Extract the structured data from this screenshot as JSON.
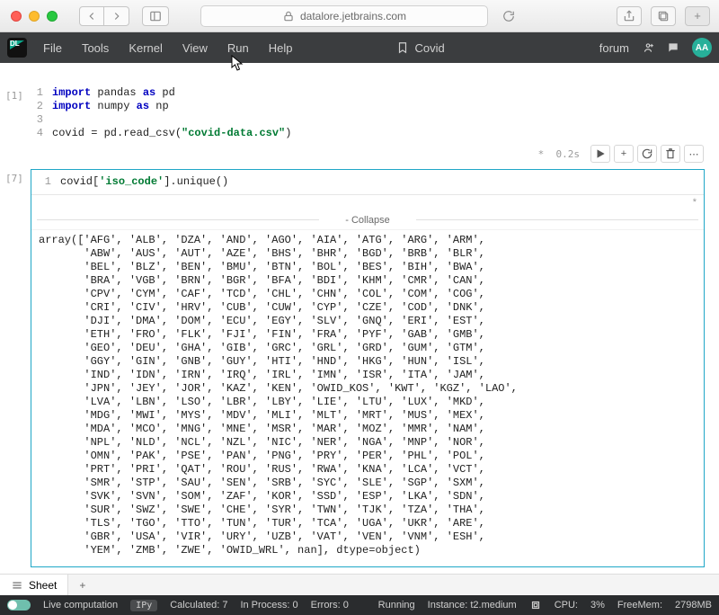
{
  "browser": {
    "url": "datalore.jetbrains.com"
  },
  "app": {
    "menus": [
      "File",
      "Tools",
      "Kernel",
      "View",
      "Run",
      "Help"
    ],
    "bookmark_label": "Covid",
    "forum_label": "forum",
    "avatar_initials": "AA"
  },
  "cells": {
    "cell1": {
      "prompt": "[1]",
      "lines": [
        {
          "n": "1",
          "pre": "",
          "kw": "import",
          "mid": " pandas ",
          "kw2": "as",
          "post": " pd"
        },
        {
          "n": "2",
          "pre": "",
          "kw": "import",
          "mid": " numpy ",
          "kw2": "as",
          "post": " np"
        },
        {
          "n": "3",
          "pre": "",
          "kw": "",
          "mid": "",
          "kw2": "",
          "post": ""
        },
        {
          "n": "4",
          "pre": "covid = pd.read_csv(",
          "kw": "",
          "mid": "",
          "kw2": "",
          "post": ")",
          "str": "\"covid-data.csv\""
        }
      ]
    },
    "cell2": {
      "prompt": "[7]",
      "exec_time": "0.2s",
      "modified": "*",
      "code_line_no": "1",
      "code_pre": "covid[",
      "code_str": "'iso_code'",
      "code_post": "].unique()",
      "collapse_label": "- Collapse",
      "output": "array(['AFG', 'ALB', 'DZA', 'AND', 'AGO', 'AIA', 'ATG', 'ARG', 'ARM',\n       'ABW', 'AUS', 'AUT', 'AZE', 'BHS', 'BHR', 'BGD', 'BRB', 'BLR',\n       'BEL', 'BLZ', 'BEN', 'BMU', 'BTN', 'BOL', 'BES', 'BIH', 'BWA',\n       'BRA', 'VGB', 'BRN', 'BGR', 'BFA', 'BDI', 'KHM', 'CMR', 'CAN',\n       'CPV', 'CYM', 'CAF', 'TCD', 'CHL', 'CHN', 'COL', 'COM', 'COG',\n       'CRI', 'CIV', 'HRV', 'CUB', 'CUW', 'CYP', 'CZE', 'COD', 'DNK',\n       'DJI', 'DMA', 'DOM', 'ECU', 'EGY', 'SLV', 'GNQ', 'ERI', 'EST',\n       'ETH', 'FRO', 'FLK', 'FJI', 'FIN', 'FRA', 'PYF', 'GAB', 'GMB',\n       'GEO', 'DEU', 'GHA', 'GIB', 'GRC', 'GRL', 'GRD', 'GUM', 'GTM',\n       'GGY', 'GIN', 'GNB', 'GUY', 'HTI', 'HND', 'HKG', 'HUN', 'ISL',\n       'IND', 'IDN', 'IRN', 'IRQ', 'IRL', 'IMN', 'ISR', 'ITA', 'JAM',\n       'JPN', 'JEY', 'JOR', 'KAZ', 'KEN', 'OWID_KOS', 'KWT', 'KGZ', 'LAO',\n       'LVA', 'LBN', 'LSO', 'LBR', 'LBY', 'LIE', 'LTU', 'LUX', 'MKD',\n       'MDG', 'MWI', 'MYS', 'MDV', 'MLI', 'MLT', 'MRT', 'MUS', 'MEX',\n       'MDA', 'MCO', 'MNG', 'MNE', 'MSR', 'MAR', 'MOZ', 'MMR', 'NAM',\n       'NPL', 'NLD', 'NCL', 'NZL', 'NIC', 'NER', 'NGA', 'MNP', 'NOR',\n       'OMN', 'PAK', 'PSE', 'PAN', 'PNG', 'PRY', 'PER', 'PHL', 'POL',\n       'PRT', 'PRI', 'QAT', 'ROU', 'RUS', 'RWA', 'KNA', 'LCA', 'VCT',\n       'SMR', 'STP', 'SAU', 'SEN', 'SRB', 'SYC', 'SLE', 'SGP', 'SXM',\n       'SVK', 'SVN', 'SOM', 'ZAF', 'KOR', 'SSD', 'ESP', 'LKA', 'SDN',\n       'SUR', 'SWZ', 'SWE', 'CHE', 'SYR', 'TWN', 'TJK', 'TZA', 'THA',\n       'TLS', 'TGO', 'TTO', 'TUN', 'TUR', 'TCA', 'UGA', 'UKR', 'ARE',\n       'GBR', 'USA', 'VIR', 'URY', 'UZB', 'VAT', 'VEN', 'VNM', 'ESH',\n       'YEM', 'ZMB', 'ZWE', 'OWID_WRL', nan], dtype=object)"
    }
  },
  "bottom": {
    "sheet_label": "Sheet"
  },
  "status": {
    "live": "Live computation",
    "lang": "IPy",
    "calculated": "Calculated: 7",
    "inprocess": "In Process: 0",
    "errors": "Errors: 0",
    "running": "Running",
    "instance": "Instance: t2.medium",
    "cpu_label": "CPU:",
    "cpu_val": "3%",
    "mem_label": "FreeMem:",
    "mem_val": "2798MB"
  }
}
